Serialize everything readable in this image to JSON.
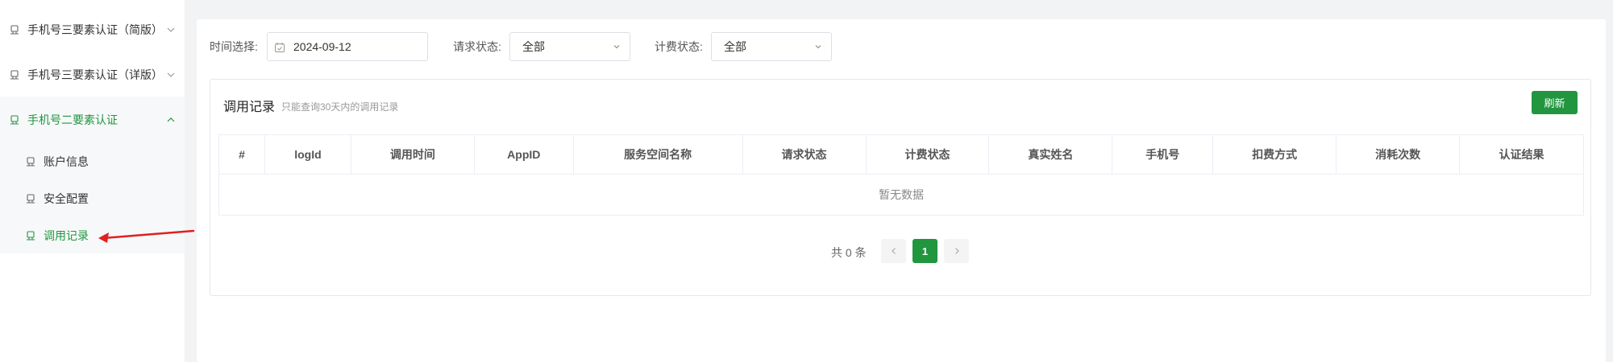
{
  "sidebar": {
    "items": [
      {
        "label": "手机号三要素认证（简版）",
        "expanded": false
      },
      {
        "label": "手机号三要素认证（详版）",
        "expanded": false
      },
      {
        "label": "手机号二要素认证",
        "expanded": true
      },
      {
        "label": "账户信息"
      },
      {
        "label": "安全配置"
      },
      {
        "label": "调用记录"
      }
    ],
    "active_color": "#21963f"
  },
  "filters": {
    "date_label": "时间选择:",
    "date_value": "2024-09-12",
    "request_status_label": "请求状态:",
    "request_status_value": "全部",
    "billing_status_label": "计费状态:",
    "billing_status_value": "全部"
  },
  "records": {
    "title": "调用记录",
    "subtitle": "只能查询30天内的调用记录",
    "refresh_label": "刷新",
    "columns": [
      "#",
      "logId",
      "调用时间",
      "AppID",
      "服务空间名称",
      "请求状态",
      "计费状态",
      "真实姓名",
      "手机号",
      "扣费方式",
      "消耗次数",
      "认证结果"
    ],
    "empty_text": "暂无数据"
  },
  "pagination": {
    "total_text": "共 0 条",
    "current_page": "1"
  },
  "colors": {
    "accent": "#21963f",
    "annotation_arrow": "#e02020"
  }
}
